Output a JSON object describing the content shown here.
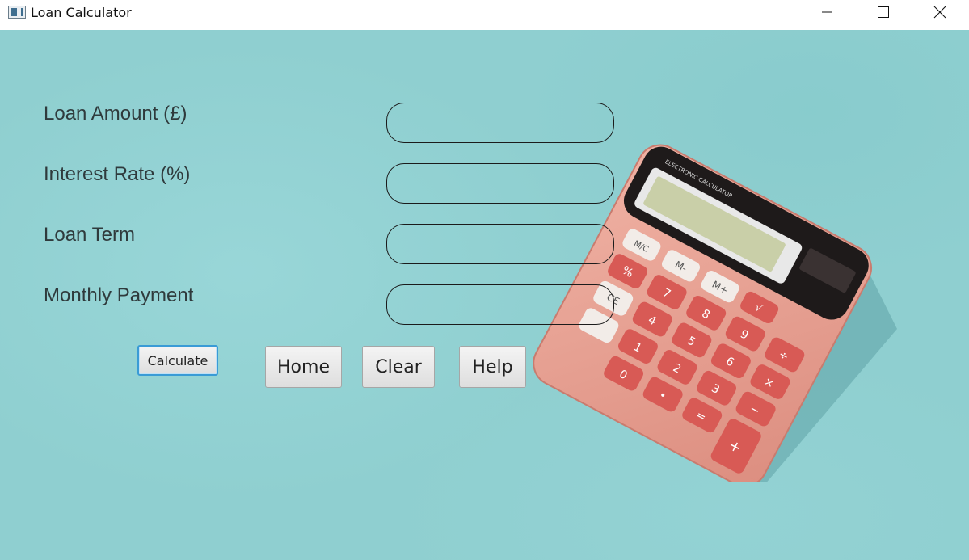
{
  "window": {
    "title": "Loan Calculator",
    "controls": {
      "minimize": "minimize-icon",
      "maximize": "maximize-icon",
      "close": "close-icon"
    }
  },
  "form": {
    "fields": [
      {
        "label": "Loan Amount (£)",
        "value": "",
        "placeholder": ""
      },
      {
        "label": "Interest Rate (%)",
        "value": "",
        "placeholder": ""
      },
      {
        "label": "Loan Term",
        "value": "",
        "placeholder": ""
      },
      {
        "label": "Monthly Payment",
        "value": "",
        "placeholder": ""
      }
    ]
  },
  "buttons": {
    "calculate": "Calculate",
    "home": "Home",
    "clear": "Clear",
    "help": "Help"
  },
  "calculator_image": {
    "brand_text": "ELECTRONIC CALCULATOR",
    "keys": [
      "M/C",
      "M-",
      "M+",
      "%",
      "7",
      "8",
      "9",
      "÷",
      "CE",
      "4",
      "5",
      "6",
      "×",
      "1",
      "2",
      "3",
      "−",
      "0",
      "•",
      "=",
      "+"
    ]
  },
  "colors": {
    "background": "#8fcfd0",
    "field_border": "#1b1b1b",
    "focus_border": "#3a9bd6",
    "calculator_body": "#e8a394",
    "calculator_keys": "#d85a55"
  }
}
